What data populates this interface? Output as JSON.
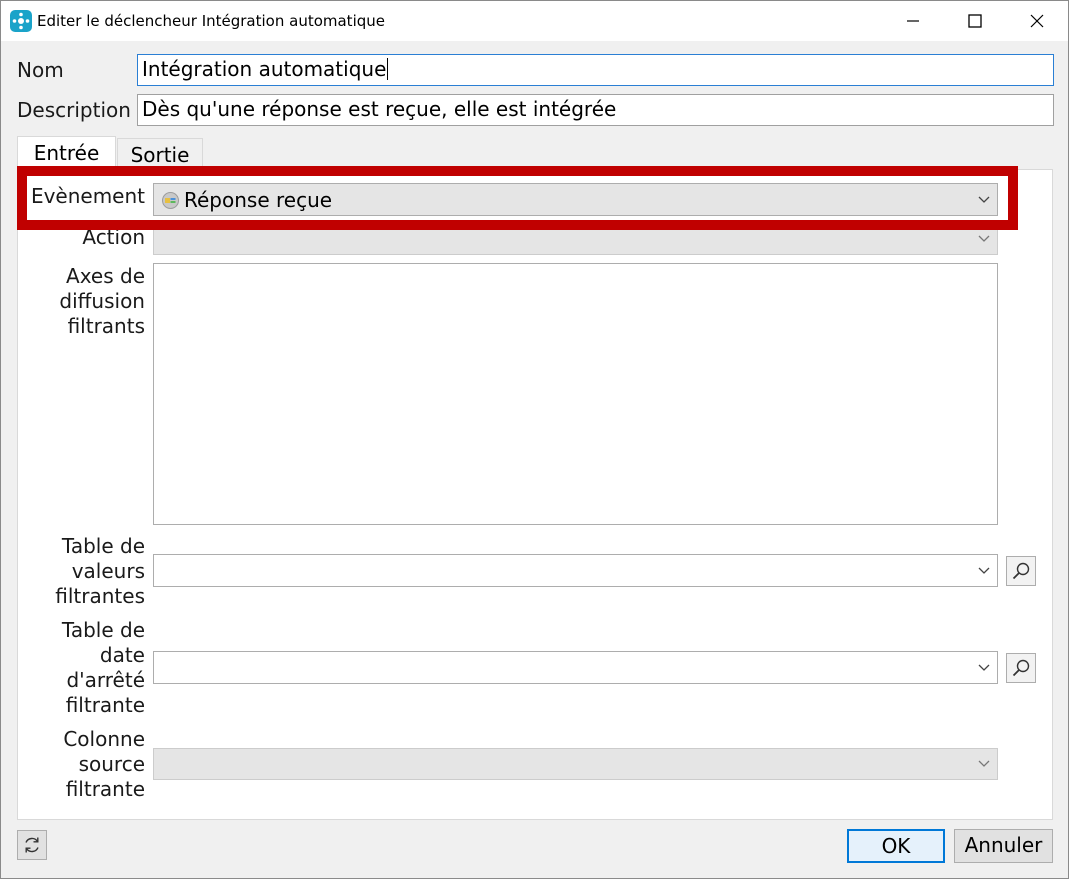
{
  "window": {
    "title": "Editer le déclencheur Intégration automatique",
    "icon": "app-icon",
    "controls": [
      "minimize-icon",
      "maximize-icon",
      "close-icon"
    ]
  },
  "form": {
    "nom_label": "Nom",
    "nom_value": "Intégration automatique",
    "description_label": "Description",
    "description_value": "Dès qu'une réponse est reçue, elle est intégrée"
  },
  "tabs": [
    {
      "label": "Entrée",
      "active": true
    },
    {
      "label": "Sortie",
      "active": false
    }
  ],
  "entree": {
    "evenement_label": "Evènement",
    "evenement_value": "Réponse reçue",
    "action_label": "Action",
    "axes_label_1": "Axes de",
    "axes_label_2": "diffusion",
    "axes_label_3": "filtrants",
    "table_valeurs_label_1": "Table de",
    "table_valeurs_label_2": "valeurs",
    "table_valeurs_label_3": "filtrantes",
    "table_date_label_1": "Table de",
    "table_date_label_2": "date",
    "table_date_label_3": "d'arrêté",
    "table_date_label_4": "filtrante",
    "colonne_label_1": "Colonne",
    "colonne_label_2": "source",
    "colonne_label_3": "filtrante"
  },
  "footer": {
    "ok_label": "OK",
    "cancel_label": "Annuler"
  },
  "colors": {
    "highlight": "#c00000",
    "accent": "#0078d7",
    "app_icon": "#1aa3c9"
  }
}
